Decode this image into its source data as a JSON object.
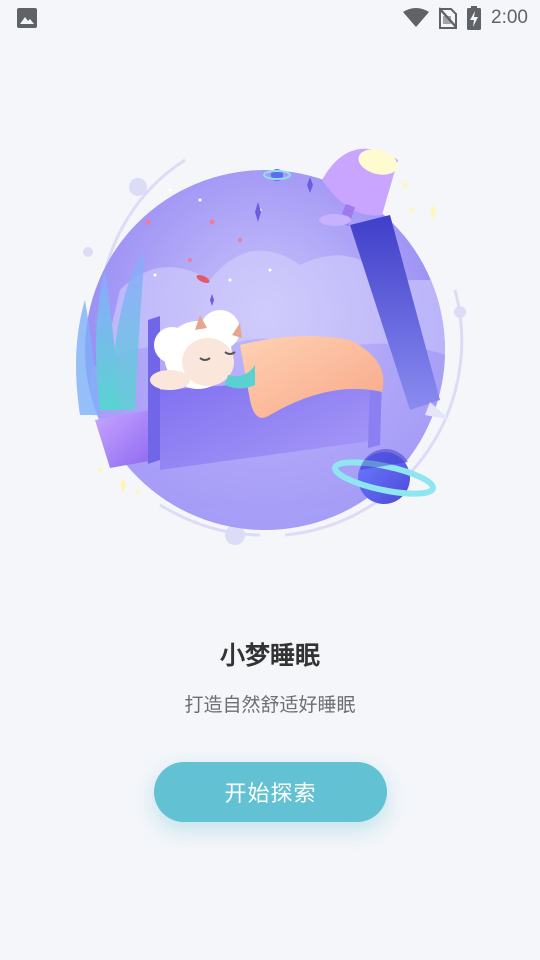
{
  "status_bar": {
    "time": "2:00",
    "icons": [
      "image-icon",
      "wifi-icon",
      "no-sim-icon",
      "battery-charging-icon"
    ]
  },
  "illustration": {
    "subject": "sheep sleeping on bed with lamp, planets and plant",
    "accent": "#8b7cf2"
  },
  "onboarding": {
    "title": "小梦睡眠",
    "subtitle": "打造自然舒适好睡眠",
    "start_button_label": "开始探索"
  },
  "colors": {
    "background": "#f4f6fa",
    "button": "#62c1d2",
    "title": "#333333",
    "subtitle": "#6c6f73"
  }
}
